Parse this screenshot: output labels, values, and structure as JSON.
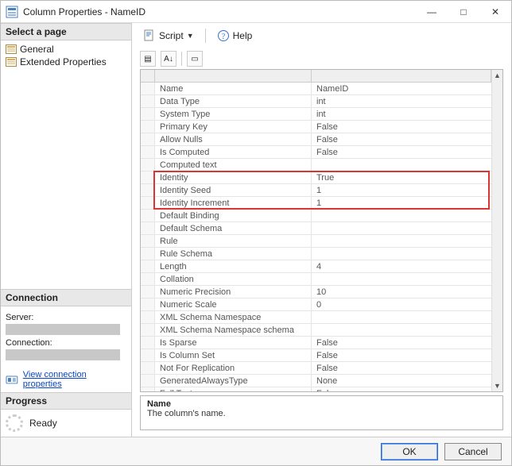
{
  "window": {
    "title": "Column Properties - NameID",
    "minimize": "—",
    "maximize": "□",
    "close": "✕"
  },
  "left": {
    "select_page_label": "Select a page",
    "pages": [
      {
        "label": "General"
      },
      {
        "label": "Extended Properties"
      }
    ],
    "connection_label": "Connection",
    "server_label": "Server:",
    "connection_field_label": "Connection:",
    "view_conn_props": "View connection properties",
    "progress_label": "Progress",
    "ready": "Ready"
  },
  "toolbar": {
    "script_label": "Script",
    "help_label": "Help"
  },
  "mini_toolbar": {
    "btn1": "▤",
    "btn2": "A↓",
    "btn3": "▭"
  },
  "grid": {
    "selected_name": "Name",
    "selected_desc": "The column's name.",
    "rows": [
      {
        "name": "Name",
        "value": "NameID"
      },
      {
        "name": "Data Type",
        "value": "int"
      },
      {
        "name": "System Type",
        "value": "int"
      },
      {
        "name": "Primary Key",
        "value": "False"
      },
      {
        "name": "Allow Nulls",
        "value": "False"
      },
      {
        "name": "Is Computed",
        "value": "False"
      },
      {
        "name": "Computed text",
        "value": ""
      },
      {
        "name": "Identity",
        "value": "True",
        "highlight": true
      },
      {
        "name": "Identity Seed",
        "value": "1",
        "highlight": true
      },
      {
        "name": "Identity Increment",
        "value": "1",
        "highlight": true
      },
      {
        "name": "Default Binding",
        "value": ""
      },
      {
        "name": "Default Schema",
        "value": ""
      },
      {
        "name": "Rule",
        "value": ""
      },
      {
        "name": "Rule Schema",
        "value": ""
      },
      {
        "name": "Length",
        "value": "4"
      },
      {
        "name": "Collation",
        "value": ""
      },
      {
        "name": "Numeric Precision",
        "value": "10"
      },
      {
        "name": "Numeric Scale",
        "value": "0"
      },
      {
        "name": "XML Schema Namespace",
        "value": ""
      },
      {
        "name": "XML Schema Namespace schema",
        "value": ""
      },
      {
        "name": "Is Sparse",
        "value": "False"
      },
      {
        "name": "Is Column Set",
        "value": "False"
      },
      {
        "name": "Not For Replication",
        "value": "False"
      },
      {
        "name": "GeneratedAlwaysType",
        "value": "None"
      },
      {
        "name": "Full Text",
        "value": "False"
      }
    ]
  },
  "footer": {
    "ok": "OK",
    "cancel": "Cancel"
  }
}
